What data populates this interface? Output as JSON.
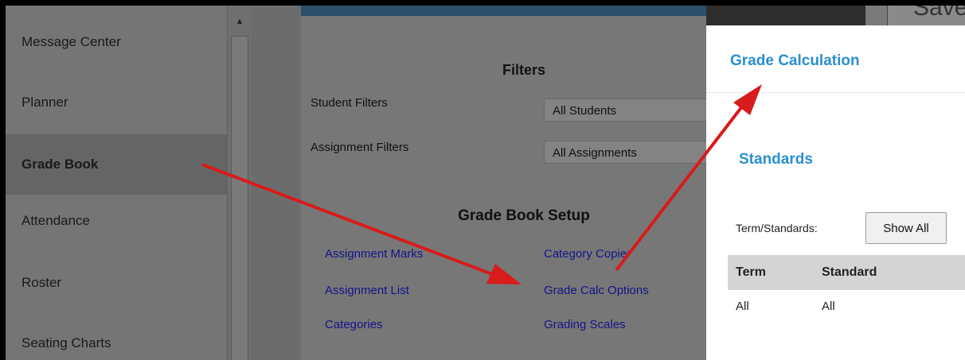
{
  "sidebar": {
    "items": [
      {
        "label": "Message Center"
      },
      {
        "label": "Planner"
      },
      {
        "label": "Grade Book"
      },
      {
        "label": "Attendance"
      },
      {
        "label": "Roster"
      },
      {
        "label": "Seating Charts"
      }
    ]
  },
  "header": {
    "save_label": "Save",
    "stripe_mark": "6"
  },
  "filters": {
    "title": "Filters",
    "student_label": "Student Filters",
    "student_value": "All Students",
    "assignment_label": "Assignment Filters",
    "assignment_value": "All Assignments"
  },
  "setup": {
    "title": "Grade Book Setup",
    "links": [
      {
        "label": "Assignment Marks"
      },
      {
        "label": "Category Copier"
      },
      {
        "label": "Assignment List"
      },
      {
        "label": "Grade Calc Options"
      },
      {
        "label": "Categories"
      },
      {
        "label": "Grading Scales"
      }
    ]
  },
  "panel": {
    "title": "Grade Calculation",
    "standards_title": "Standards",
    "term_label": "Term/Standards:",
    "show_all": "Show All",
    "columns": [
      "Term",
      "Standard"
    ],
    "rows": [
      [
        "All",
        "All"
      ]
    ]
  },
  "colors": {
    "accent": "#2b8fce",
    "link": "#14148a",
    "arrow": "#d81b1b"
  }
}
